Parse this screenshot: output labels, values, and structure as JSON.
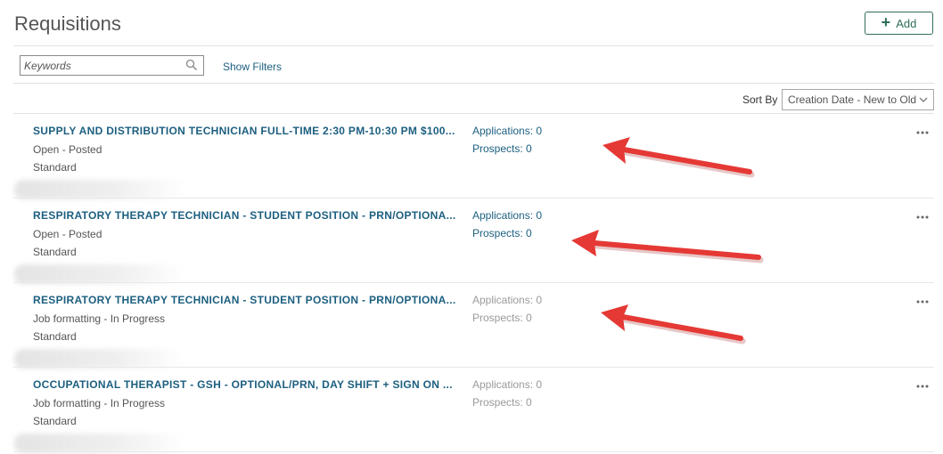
{
  "header": {
    "title": "Requisitions",
    "add_label": "Add"
  },
  "filters": {
    "search_placeholder": "Keywords",
    "show_filters": "Show Filters"
  },
  "sort": {
    "label": "Sort By",
    "selected": "Creation Date - New to Old"
  },
  "requisitions": [
    {
      "title": "SUPPLY AND DISTRIBUTION TECHNICIAN FULL-TIME 2:30 PM-10:30 PM $100...",
      "status": "Open - Posted",
      "type": "Standard",
      "applications": "Applications: 0",
      "prospects": "Prospects: 0",
      "active": true
    },
    {
      "title": "RESPIRATORY THERAPY TECHNICIAN - STUDENT POSITION - PRN/OPTIONA...",
      "status": "Open - Posted",
      "type": "Standard",
      "applications": "Applications: 0",
      "prospects": "Prospects: 0",
      "active": true
    },
    {
      "title": "RESPIRATORY THERAPY TECHNICIAN - STUDENT POSITION - PRN/OPTIONA...",
      "status": "Job formatting - In Progress",
      "type": "Standard",
      "applications": "Applications: 0",
      "prospects": "Prospects: 0",
      "active": false
    },
    {
      "title": "OCCUPATIONAL THERAPIST - GSH - OPTIONAL/PRN, DAY SHIFT + SIGN ON ...",
      "status": "Job formatting - In Progress",
      "type": "Standard",
      "applications": "Applications: 0",
      "prospects": "Prospects: 0",
      "active": false
    }
  ],
  "colors": {
    "link": "#1c5f80",
    "muted": "#9a9a9a",
    "accent": "#2f6f5a",
    "arrow": "#e53935"
  },
  "icons": {
    "add": "plus-icon",
    "search": "search-icon",
    "sort": "chevron-down-icon",
    "more": "more-icon"
  }
}
